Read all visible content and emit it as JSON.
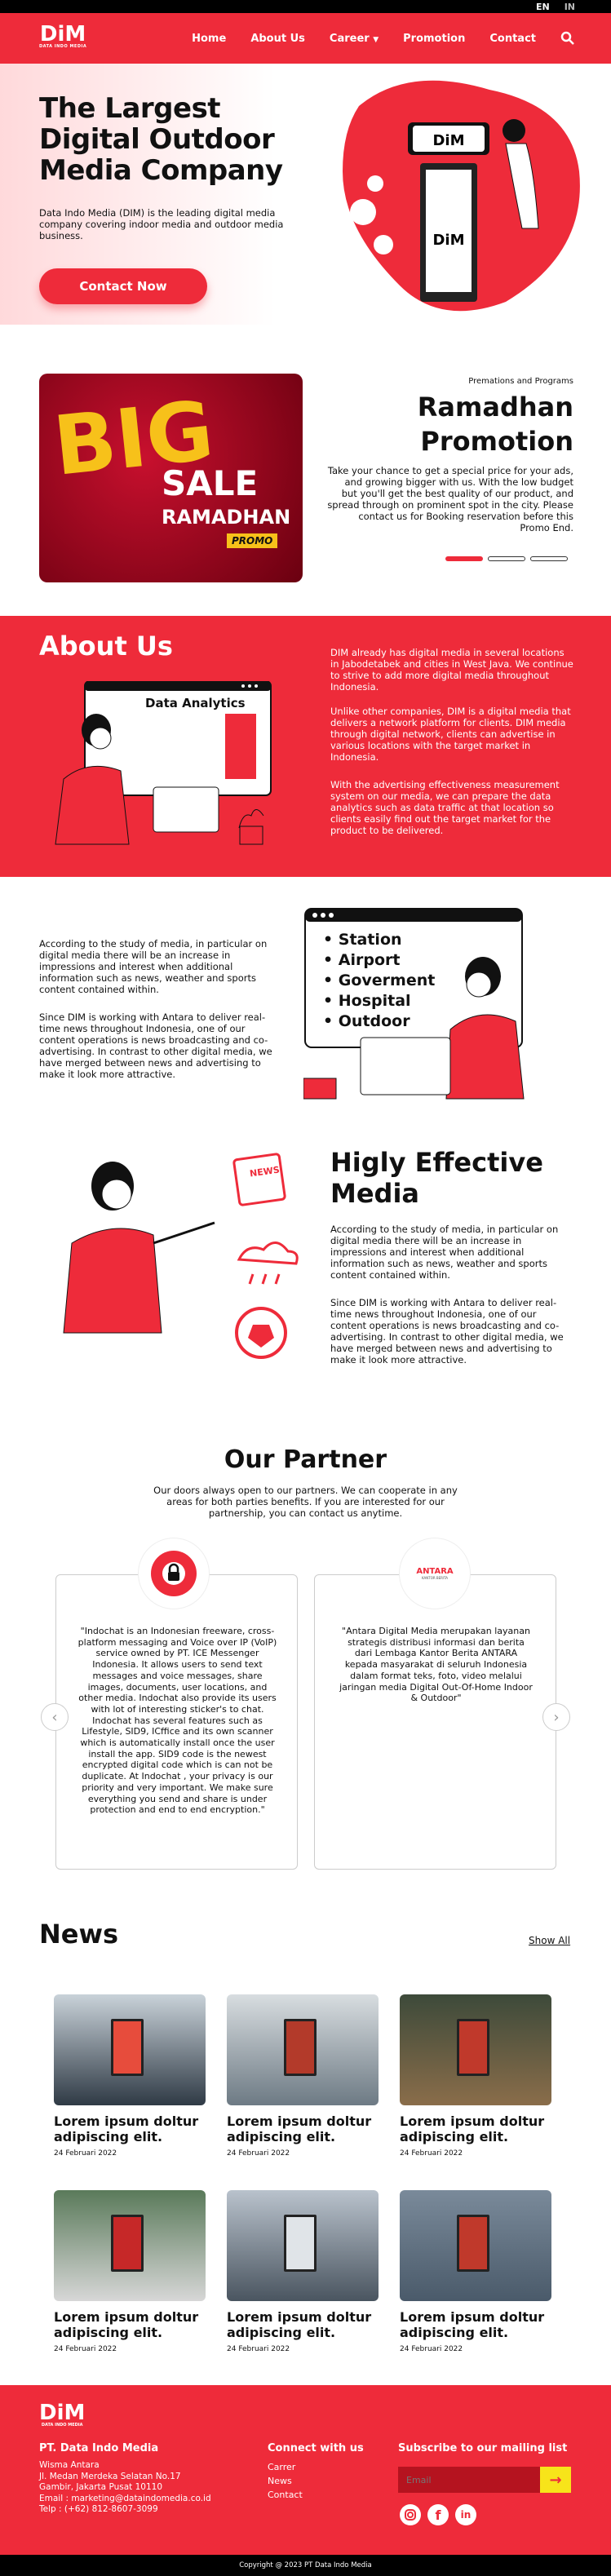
{
  "lang": {
    "en": "EN",
    "in": "IN"
  },
  "brand": {
    "logo_text": "DiM",
    "tagline": "DATA INDO MEDIA"
  },
  "nav": {
    "home": "Home",
    "about": "About Us",
    "career": "Career",
    "promotion": "Promotion",
    "contact": "Contact"
  },
  "hero": {
    "title": "The Largest Digital Outdoor Media Company",
    "description": "Data Indo Media (DIM) is the leading digital media company covering indoor media and outdoor media business.",
    "cta": "Contact Now",
    "kiosk_logo": "DiM"
  },
  "promo": {
    "kicker": "Premations and Programs",
    "title_line1": "Ramadhan",
    "title_line2": "Promotion",
    "description": "Take your chance to get a special price for your ads, and growing bigger with us. With the low budget but you'll get the best quality of our product, and spread through on prominent spot in the city. Please contact us for Booking reservation before this Promo End.",
    "banner": {
      "big": "BIG",
      "sale": "SALE",
      "ramadhan": "RAMADHAN",
      "promo": "PROMO"
    }
  },
  "about": {
    "title": "About Us",
    "illustration_label": "Data Analytics",
    "p1": "DIM already has digital media in several locations in Jabodetabek and cities in West Java. We continue to strive to add more digital media throughout Indonesia.",
    "p2": "Unlike other companies, DIM is a digital media that delivers a network platform for clients. DIM media through digital network, clients can advertise in various locations with the target market in Indonesia.",
    "p3": "With the advertising effectiveness measurement system on our media, we can prepare the data analytics such as data traffic at that location so clients easily find out the target market for the product to be delivered."
  },
  "locations": {
    "p1": "According to the study of media, in particular on digital media there will be an increase in impressions and interest when additional information such as news, weather and sports content contained within.",
    "p2": "Since DIM is working with Antara to deliver real-time news throughout Indonesia, one of our content operations is news broadcasting and co- advertising. In contrast to other digital media, we have merged between news and advertising to make it look more attractive.",
    "items": [
      "Station",
      "Airport",
      "Goverment",
      "Hospital",
      "Outdoor"
    ]
  },
  "effective": {
    "title_line1": "Higly Effective",
    "title_line2": "Media",
    "news_sign": "NEWS",
    "p1": "According to the study of media, in particular on digital media there will be an increase in impressions and interest when additional information such as news, weather and sports content contained within.",
    "p2": "Since DIM is working with Antara to deliver real-time news throughout Indonesia, one of our content operations is news broadcasting and co- advertising. In contrast to other digital media, we have merged between news and advertising to make it look more attractive."
  },
  "partner": {
    "title": "Our Partner",
    "description": "Our doors always open to our partners. We can cooperate in any areas for both parties benefits. If you are interested for our partnership, you can contact us anytime.",
    "cards": [
      {
        "text": "\"Indochat is an Indonesian freeware, cross-platform messaging and Voice over IP (VoIP) service owned by PT. ICE Messenger Indonesia. It allows users to send text messages and voice messages, share images, documents, user locations, and other media. Indochat also provide its users with lot of interesting sticker's to chat. Indochat has several features such as Lifestyle, SID9, ICffice and its own scanner which is automatically install once the user install the app. SID9 code is the newest encrypted digital code which is can not be duplicate. At Indochat , your privacy is our priority and very important. We make sure everything you send and share is under protection and end to end encryption.\""
      },
      {
        "logo": "ANTARA",
        "logo_sub": "KANTOR BERITA",
        "text": "\"Antara Digital Media merupakan layanan strategis distribusi informasi dan berita dari Lembaga Kantor Berita ANTARA kepada masyarakat di seluruh Indonesia dalam format teks, foto, video melalui jaringan media Digital Out-Of-Home Indoor & Outdoor\""
      }
    ]
  },
  "news": {
    "title": "News",
    "show_all": "Show All",
    "items": [
      {
        "title": "Lorem ipsum doltur adipiscing elit.",
        "date": "24 Februari 2022"
      },
      {
        "title": "Lorem ipsum doltur adipiscing elit.",
        "date": "24 Februari 2022"
      },
      {
        "title": "Lorem ipsum doltur adipiscing elit.",
        "date": "24 Februari 2022"
      },
      {
        "title": "Lorem ipsum doltur adipiscing elit.",
        "date": "24 Februari 2022"
      },
      {
        "title": "Lorem ipsum doltur adipiscing elit.",
        "date": "24 Februari 2022"
      },
      {
        "title": "Lorem ipsum doltur adipiscing elit.",
        "date": "24 Februari 2022"
      }
    ]
  },
  "footer": {
    "company": "PT. Data Indo Media",
    "address1": "Wisma Antara",
    "address2": "Jl. Medan Merdeka Selatan No.17",
    "address3": "Gambir, Jakarta Pusat 10110",
    "email": "Email : marketing@dataindomedia.co.id",
    "phone": "Telp   : (+62) 812-8607-3099",
    "connect_title": "Connect with us",
    "links": [
      "Carrer",
      "News",
      "Contact"
    ],
    "mailing_title": "Subscribe to our mailing list",
    "email_placeholder": "Email",
    "copyright": "Copyright @ 2023 PT Data Indo Media"
  },
  "colors": {
    "accent": "#ee2b3a",
    "dark": "#111111",
    "promo_yellow": "#f7c11a"
  }
}
